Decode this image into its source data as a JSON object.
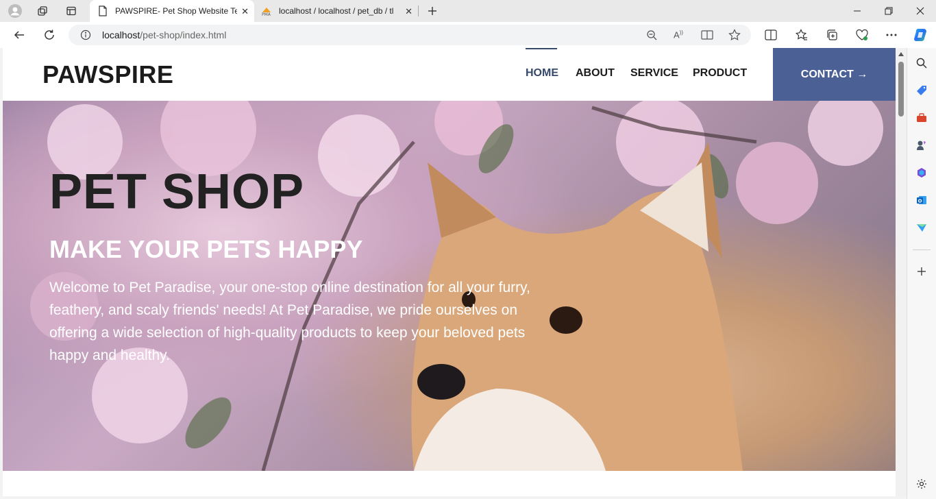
{
  "browser": {
    "tabs": [
      {
        "title": "PAWSPIRE- Pet Shop Website Ter",
        "icon": "page-icon",
        "active": true
      },
      {
        "title": "localhost / localhost / pet_db / tl",
        "icon": "phpmyadmin-icon",
        "active": false
      }
    ],
    "address": {
      "host": "localhost",
      "path": "/pet-shop/index.html"
    }
  },
  "site": {
    "brand": "PAWSPIRE",
    "nav": [
      {
        "label": "HOME",
        "active": true
      },
      {
        "label": "ABOUT",
        "active": false
      },
      {
        "label": "SERVICE",
        "active": false
      },
      {
        "label": "PRODUCT",
        "active": false
      }
    ],
    "contact_label": "CONTACT →",
    "accent_color": "#4b6196",
    "hero": {
      "title": "PET SHOP",
      "subtitle": "MAKE YOUR PETS HAPPY",
      "text": "Welcome to Pet Paradise, your one-stop online destination for all your furry, feathery, and scaly friends' needs! At Pet Paradise, we pride ourselves on offering a wide selection of high-quality products to keep your beloved pets happy and healthy."
    }
  }
}
